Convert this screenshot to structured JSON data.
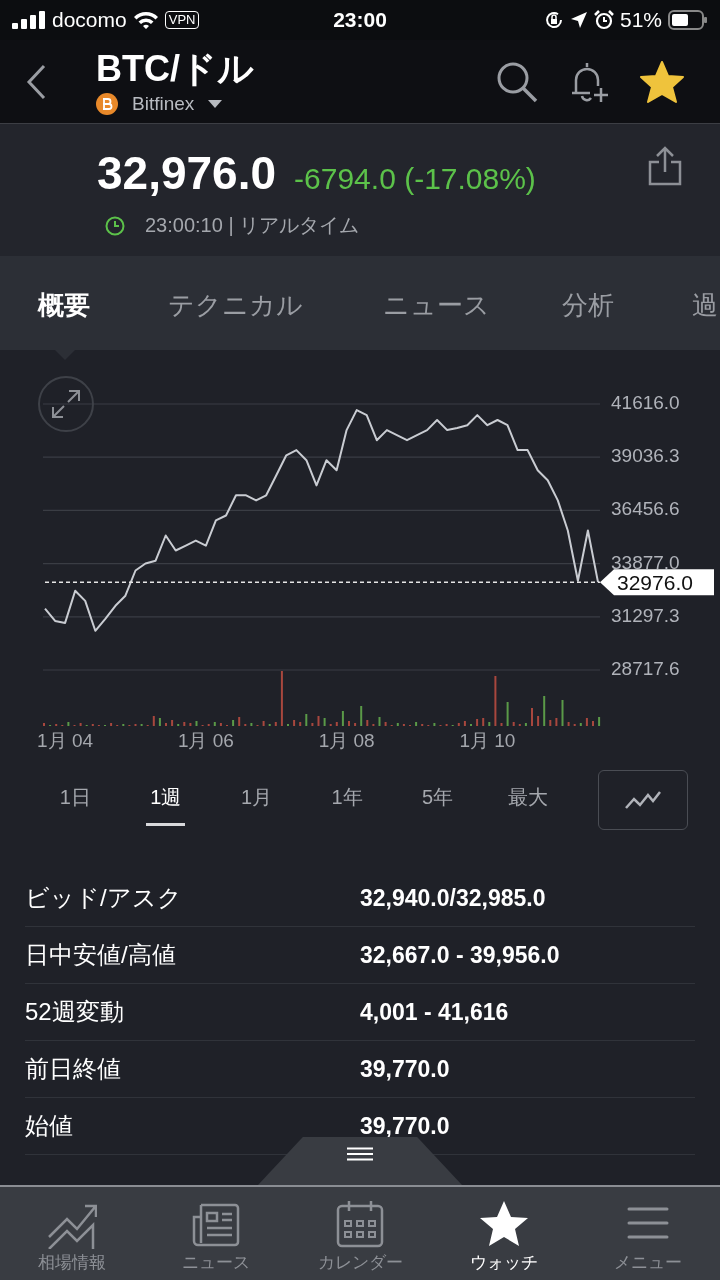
{
  "status_bar": {
    "carrier": "docomo",
    "vpn": "VPN",
    "time": "23:00",
    "battery": "51%"
  },
  "header": {
    "title": "BTC/ドル",
    "exchange": "Bitfinex",
    "favorite": true
  },
  "quote": {
    "price": "32,976.0",
    "change": "-6794.0 (-17.08%)",
    "time": "23:00:10 | リアルタイム"
  },
  "tabs": [
    {
      "label": "概要",
      "selected": true
    },
    {
      "label": "テクニカル",
      "selected": false
    },
    {
      "label": "ニュース",
      "selected": false
    },
    {
      "label": "分析",
      "selected": false
    },
    {
      "label": "過",
      "selected": false
    }
  ],
  "chart": {
    "chart_data": {
      "type": "line",
      "categories": [
        null,
        null,
        "1月 04",
        null,
        null,
        null,
        null,
        null,
        null,
        null,
        null,
        null,
        null,
        null,
        null,
        null,
        "1月 06",
        null,
        null,
        null,
        null,
        null,
        null,
        null,
        null,
        null,
        null,
        null,
        null,
        null,
        "1月 08",
        null,
        null,
        null,
        null,
        null,
        null,
        null,
        null,
        null,
        null,
        null,
        null,
        null,
        "1月 10",
        null,
        null,
        null,
        null,
        null,
        null,
        null,
        null,
        null,
        null,
        null
      ],
      "series": [
        {
          "color": "#c9ccd2",
          "values": [
            31690,
            31100,
            31000,
            32560,
            32070,
            30620,
            31200,
            31830,
            32320,
            33540,
            33880,
            34020,
            35240,
            34510,
            34750,
            34990,
            34750,
            35970,
            36210,
            37190,
            37190,
            36940,
            37190,
            38160,
            39130,
            39380,
            38890,
            37670,
            38890,
            38400,
            40350,
            41320,
            41080,
            39860,
            40350,
            40110,
            39860,
            40110,
            40350,
            40840,
            40350,
            40450,
            40590,
            41080,
            40590,
            40840,
            40590,
            39380,
            39380,
            38400,
            37920,
            36940,
            35480,
            33050,
            35480,
            32980
          ]
        }
      ],
      "ylim": [
        28717.6,
        41616.0
      ],
      "yticks": [
        {
          "value": 41616.0,
          "label": "41616.0"
        },
        {
          "value": 39036.3,
          "label": "39036.3"
        },
        {
          "value": 36456.6,
          "label": "36456.6"
        },
        {
          "value": 33877.0,
          "label": "33877.0"
        },
        {
          "value": 31297.3,
          "label": "31297.3"
        },
        {
          "value": 28717.6,
          "label": "28717.6"
        }
      ],
      "grid": true,
      "ref_lines": [
        {
          "axis": "y",
          "value": 32976.0,
          "label": "32976.0",
          "color": "#e6e6e6"
        }
      ]
    }
  },
  "ranges": [
    {
      "label": "1日",
      "selected": false
    },
    {
      "label": "1週",
      "selected": true
    },
    {
      "label": "1月",
      "selected": false
    },
    {
      "label": "1年",
      "selected": false
    },
    {
      "label": "5年",
      "selected": false
    },
    {
      "label": "最大",
      "selected": false
    }
  ],
  "stats": [
    {
      "label": "ビッド/アスク",
      "value": "32,940.0/32,985.0"
    },
    {
      "label": "日中安値/高値",
      "value": "32,667.0 - 39,956.0"
    },
    {
      "label": "52週変動",
      "value": "4,001 - 41,616"
    },
    {
      "label": "前日終値",
      "value": "39,770.0"
    },
    {
      "label": "始値",
      "value": "39,770.0"
    }
  ],
  "nav": [
    {
      "label": "相場情報",
      "selected": false
    },
    {
      "label": "ニュース",
      "selected": false
    },
    {
      "label": "カレンダー",
      "selected": false
    },
    {
      "label": "ウォッチ",
      "selected": true
    },
    {
      "label": "メニュー",
      "selected": false
    }
  ]
}
